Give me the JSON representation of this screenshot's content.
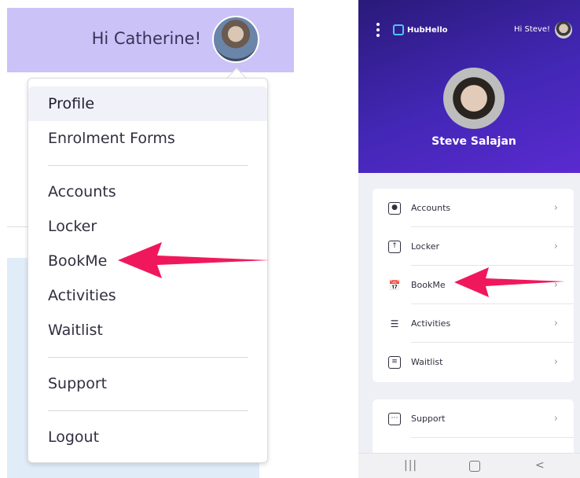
{
  "left": {
    "greeting": "Hi Catherine!",
    "menu": [
      {
        "label": "Profile",
        "active": true
      },
      {
        "label": "Enrolment Forms"
      },
      {
        "label": "Accounts"
      },
      {
        "label": "Locker"
      },
      {
        "label": "BookMe"
      },
      {
        "label": "Activities"
      },
      {
        "label": "Waitlist"
      },
      {
        "label": "Support"
      },
      {
        "label": "Logout"
      }
    ]
  },
  "right": {
    "brand": "HubHello",
    "greeting": "Hi Steve!",
    "user_name": "Steve Salajan",
    "menu": [
      {
        "label": "Accounts",
        "icon": "account-box-icon"
      },
      {
        "label": "Locker",
        "icon": "locker-upload-icon"
      },
      {
        "label": "BookMe",
        "icon": "calendar-icon"
      },
      {
        "label": "Activities",
        "icon": "list-icon"
      },
      {
        "label": "Waitlist",
        "icon": "waitlist-icon"
      }
    ],
    "menu2": [
      {
        "label": "Support",
        "icon": "support-chat-icon"
      }
    ],
    "navbar": {
      "recents": "|||",
      "back": "<"
    }
  },
  "colors": {
    "left_header_bg": "#cbc2f7",
    "right_header_bg": "#4327b6",
    "arrow": "#f0185c"
  }
}
